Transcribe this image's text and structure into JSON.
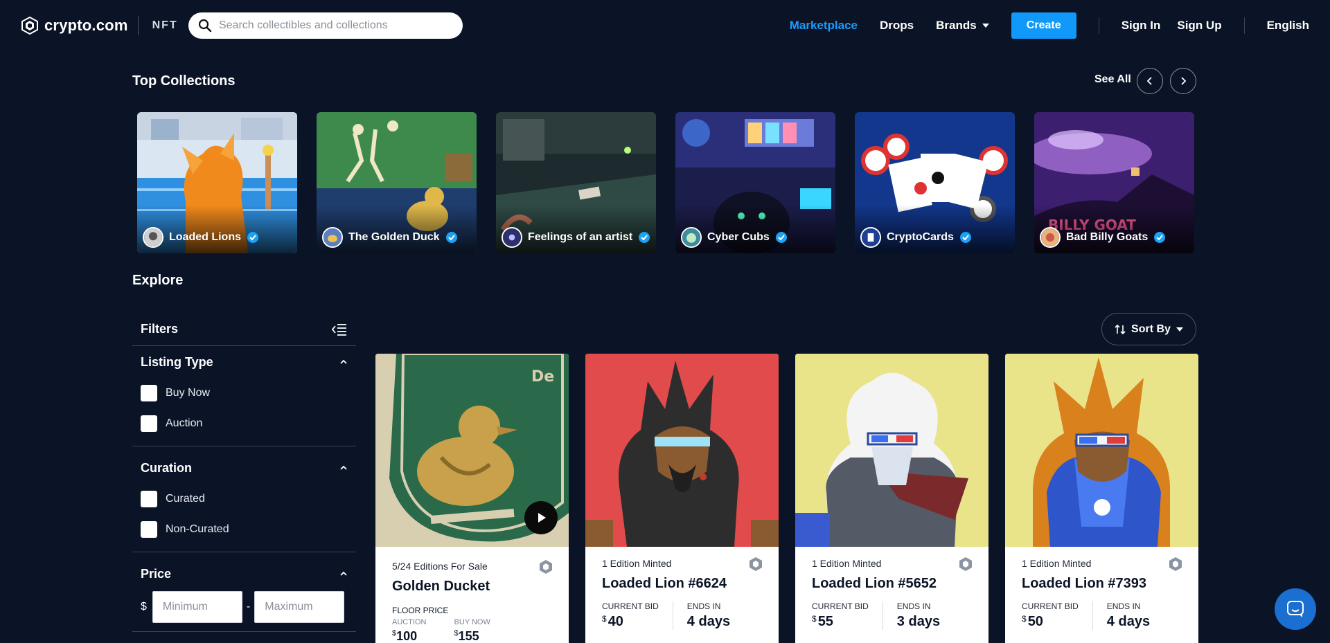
{
  "header": {
    "logo_text": "crypto.com",
    "logo_suffix": "NFT",
    "search_placeholder": "Search collectibles and collections",
    "nav": {
      "marketplace": "Marketplace",
      "drops": "Drops",
      "brands": "Brands",
      "create": "Create",
      "sign_in": "Sign In",
      "sign_up": "Sign Up",
      "language": "English"
    }
  },
  "top_collections": {
    "title": "Top Collections",
    "see_all": "See All",
    "items": [
      {
        "name": "Loaded Lions"
      },
      {
        "name": "The Golden Duck"
      },
      {
        "name": "Feelings of an artist"
      },
      {
        "name": "Cyber Cubs"
      },
      {
        "name": "CryptoCards"
      },
      {
        "name": "Bad Billy Goats"
      }
    ]
  },
  "explore": {
    "title": "Explore",
    "sort_by": "Sort By",
    "filters": {
      "title": "Filters",
      "listing_type": {
        "title": "Listing Type",
        "options": [
          "Buy Now",
          "Auction"
        ]
      },
      "curation": {
        "title": "Curation",
        "options": [
          "Curated",
          "Non-Curated"
        ]
      },
      "price": {
        "title": "Price",
        "currency": "$",
        "min_placeholder": "Minimum",
        "max_placeholder": "Maximum",
        "separator": "-"
      }
    }
  },
  "cards": [
    {
      "meta": "5/24 Editions For Sale",
      "title": "Golden Ducket",
      "floor_label": "FLOOR PRICE",
      "auction_label": "AUCTION",
      "auction_value": "100",
      "buy_now_label": "BUY NOW",
      "buy_now_value": "155"
    },
    {
      "meta": "1 Edition Minted",
      "title": "Loaded Lion #6624",
      "bid_label": "CURRENT BID",
      "bid_value": "40",
      "ends_label": "ENDS IN",
      "ends_value": "4 days"
    },
    {
      "meta": "1 Edition Minted",
      "title": "Loaded Lion #5652",
      "bid_label": "CURRENT BID",
      "bid_value": "55",
      "ends_label": "ENDS IN",
      "ends_value": "3 days"
    },
    {
      "meta": "1 Edition Minted",
      "title": "Loaded Lion #7393",
      "bid_label": "CURRENT BID",
      "bid_value": "50",
      "ends_label": "ENDS IN",
      "ends_value": "4 days"
    }
  ],
  "currency_symbol": "$",
  "colors": {
    "background": "#0b1426",
    "accent": "#1199fa",
    "active_link": "#1b9cfc",
    "verified": "#1da1f2"
  }
}
